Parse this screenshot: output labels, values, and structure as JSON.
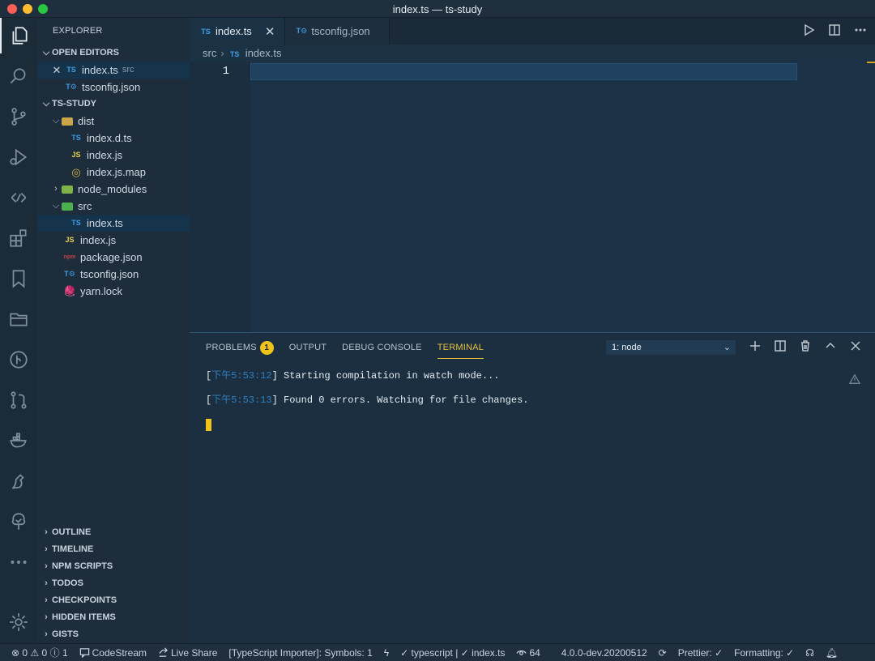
{
  "window": {
    "title": "index.ts — ts-study"
  },
  "activity_bar": [
    {
      "name": "explorer-icon",
      "active": true
    },
    {
      "name": "search-icon"
    },
    {
      "name": "source-control-icon"
    },
    {
      "name": "run-debug-icon"
    },
    {
      "name": "live-share-icon"
    },
    {
      "name": "extensions-icon"
    },
    {
      "name": "bookmarks-icon"
    },
    {
      "name": "project-manager-icon"
    },
    {
      "name": "git-graph-icon"
    },
    {
      "name": "pull-requests-icon"
    },
    {
      "name": "docker-icon"
    },
    {
      "name": "codestream-icon"
    },
    {
      "name": "gitlens-tree-icon"
    },
    {
      "name": "more-icon"
    },
    {
      "name": "settings-gear-icon"
    }
  ],
  "sidebar": {
    "title": "EXPLORER",
    "open_editors": {
      "header": "OPEN EDITORS",
      "items": [
        {
          "name": "index.ts",
          "suffix": "src",
          "icon": "TS"
        },
        {
          "name": "tsconfig.json",
          "icon": "T⚙"
        }
      ]
    },
    "project": {
      "header": "TS-STUDY",
      "tree": [
        {
          "label": "dist",
          "type": "folder",
          "expanded": true,
          "depth": 1
        },
        {
          "label": "index.d.ts",
          "icon": "TS",
          "depth": 2
        },
        {
          "label": "index.js",
          "icon": "JS",
          "depth": 2
        },
        {
          "label": "index.js.map",
          "icon": "◎",
          "depth": 2
        },
        {
          "label": "node_modules",
          "type": "folder",
          "expanded": false,
          "depth": 1
        },
        {
          "label": "src",
          "type": "folder",
          "expanded": true,
          "depth": 1
        },
        {
          "label": "index.ts",
          "icon": "TS",
          "depth": 2,
          "selected": true
        },
        {
          "label": "index.js",
          "icon": "JS",
          "depth": 1
        },
        {
          "label": "package.json",
          "icon": "npm",
          "depth": 1
        },
        {
          "label": "tsconfig.json",
          "icon": "T⚙",
          "depth": 1
        },
        {
          "label": "yarn.lock",
          "icon": "🧶",
          "depth": 1
        }
      ]
    },
    "bottom_sections": [
      "OUTLINE",
      "TIMELINE",
      "NPM SCRIPTS",
      "TODOS",
      "CHECKPOINTS",
      "HIDDEN ITEMS",
      "GISTS"
    ]
  },
  "editor": {
    "tabs": [
      {
        "label": "index.ts",
        "icon": "TS",
        "active": true,
        "close": "✕"
      },
      {
        "label": "tsconfig.json",
        "icon": "T⚙",
        "active": false
      }
    ],
    "breadcrumb": {
      "folder": "src",
      "file_icon": "TS",
      "file": "index.ts"
    },
    "line_number": "1"
  },
  "panel": {
    "tabs": [
      "PROBLEMS",
      "OUTPUT",
      "DEBUG CONSOLE",
      "TERMINAL"
    ],
    "problems_count": "1",
    "active_tab": "TERMINAL",
    "terminal_select": "1: node",
    "terminal_lines": [
      {
        "time": "下午5:53:12",
        "text": "Starting compilation in watch mode..."
      },
      {
        "time": "下午5:53:13",
        "text": "Found 0 errors. Watching for file changes."
      }
    ]
  },
  "status_bar": {
    "errors": "0",
    "warnings": "0",
    "info": "1",
    "codestream": "CodeStream",
    "live_share": "Live Share",
    "ts_importer": "[TypeScript Importer]: Symbols: 1",
    "typescript_check": "typescript",
    "file_check": "index.ts",
    "watchers": "64",
    "ts_version": "4.0.0-dev.20200512",
    "prettier": "Prettier: ✓",
    "formatting": "Formatting: ✓"
  },
  "colors": {
    "accent_yellow": "#e6c13b",
    "ts_blue": "#3f9fe6",
    "js_yellow": "#e8d44d"
  }
}
